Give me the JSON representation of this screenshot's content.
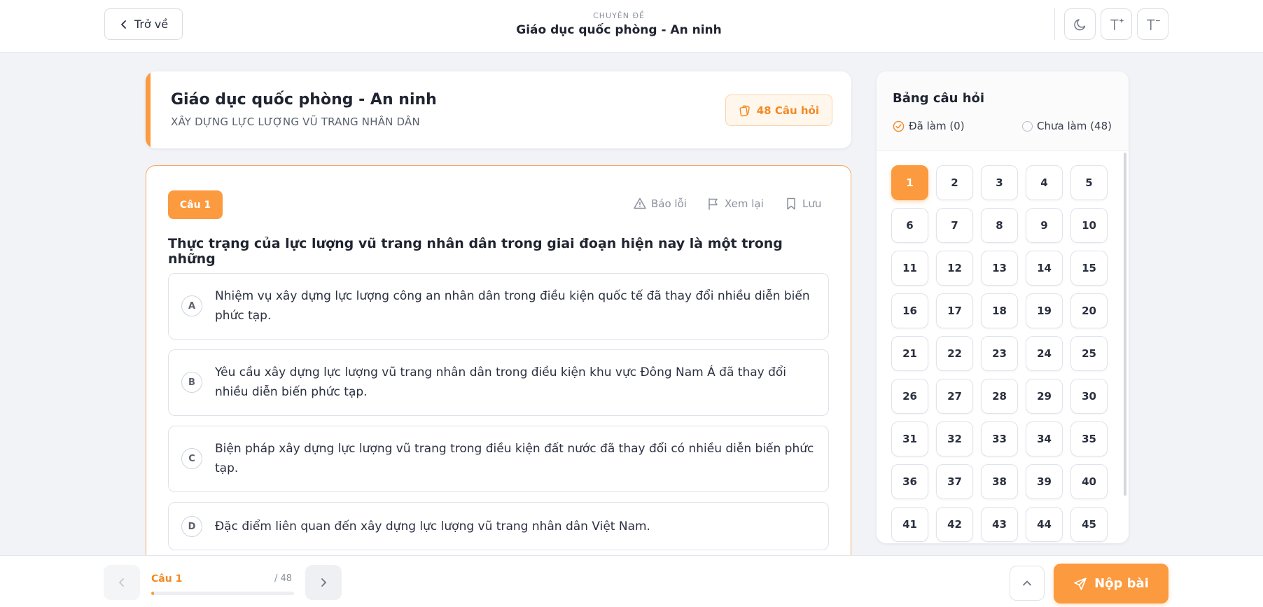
{
  "topbar": {
    "back_label": "Trở về",
    "eyebrow": "CHUYÊN ĐỀ",
    "title": "Giáo dục quốc phòng - An ninh",
    "tools": [
      {
        "icon": "moon-icon",
        "label": ""
      },
      {
        "icon": "font-increase-icon",
        "label": "T⁺"
      },
      {
        "icon": "font-decrease-icon",
        "label": "T⁻"
      }
    ]
  },
  "header": {
    "title": "Giáo dục quốc phòng - An ninh",
    "subtitle": "XÂY DỰNG LỰC LƯỢNG VŨ TRANG NHÂN DÂN",
    "badge": "48 Câu hỏi"
  },
  "question": {
    "tag": "Câu 1",
    "actions": {
      "report": "Báo lỗi",
      "review": "Xem lại",
      "save": "Lưu"
    },
    "text": "Thực trạng của lực lượng vũ trang nhân dân trong giai đoạn hiện nay là một trong những",
    "options": [
      {
        "letter": "A",
        "text": "Nhiệm vụ xây dựng lực lượng công an nhân dân trong điều kiện quốc tế đã thay đổi nhiều diễn biến phức tạp."
      },
      {
        "letter": "B",
        "text": "Yêu cầu xây dựng lực lượng vũ trang nhân dân trong điều kiện khu vực Đông Nam Á đã thay đổi nhiều diễn biến phức tạp."
      },
      {
        "letter": "C",
        "text": "Biện pháp xây dựng lực lượng vũ trang trong điều kiện đất nước đã thay đổi có nhiều diễn biến phức tạp."
      },
      {
        "letter": "D",
        "text": "Đặc điểm liên quan đến xây dựng lực lượng vũ trang nhân dân Việt Nam."
      }
    ]
  },
  "panel": {
    "title": "Bảng câu hỏi",
    "done_label": "Đã làm (0)",
    "todo_label": "Chưa làm (48)",
    "numbers": [
      "1",
      "2",
      "3",
      "4",
      "5",
      "6",
      "7",
      "8",
      "9",
      "10",
      "11",
      "12",
      "13",
      "14",
      "15",
      "16",
      "17",
      "18",
      "19",
      "20",
      "21",
      "22",
      "23",
      "24",
      "25",
      "26",
      "27",
      "28",
      "29",
      "30",
      "31",
      "32",
      "33",
      "34",
      "35",
      "36",
      "37",
      "38",
      "39",
      "40",
      "41",
      "42",
      "43",
      "44",
      "45"
    ],
    "active": "1"
  },
  "footer": {
    "current_label": "Câu 1",
    "total_label": "/ 48",
    "progress_fraction": 0.0208,
    "submit_label": "Nộp bài"
  },
  "colors": {
    "accent": "#fb9a3e",
    "accent_text": "#f28a25",
    "background": "#f1f3f7"
  }
}
